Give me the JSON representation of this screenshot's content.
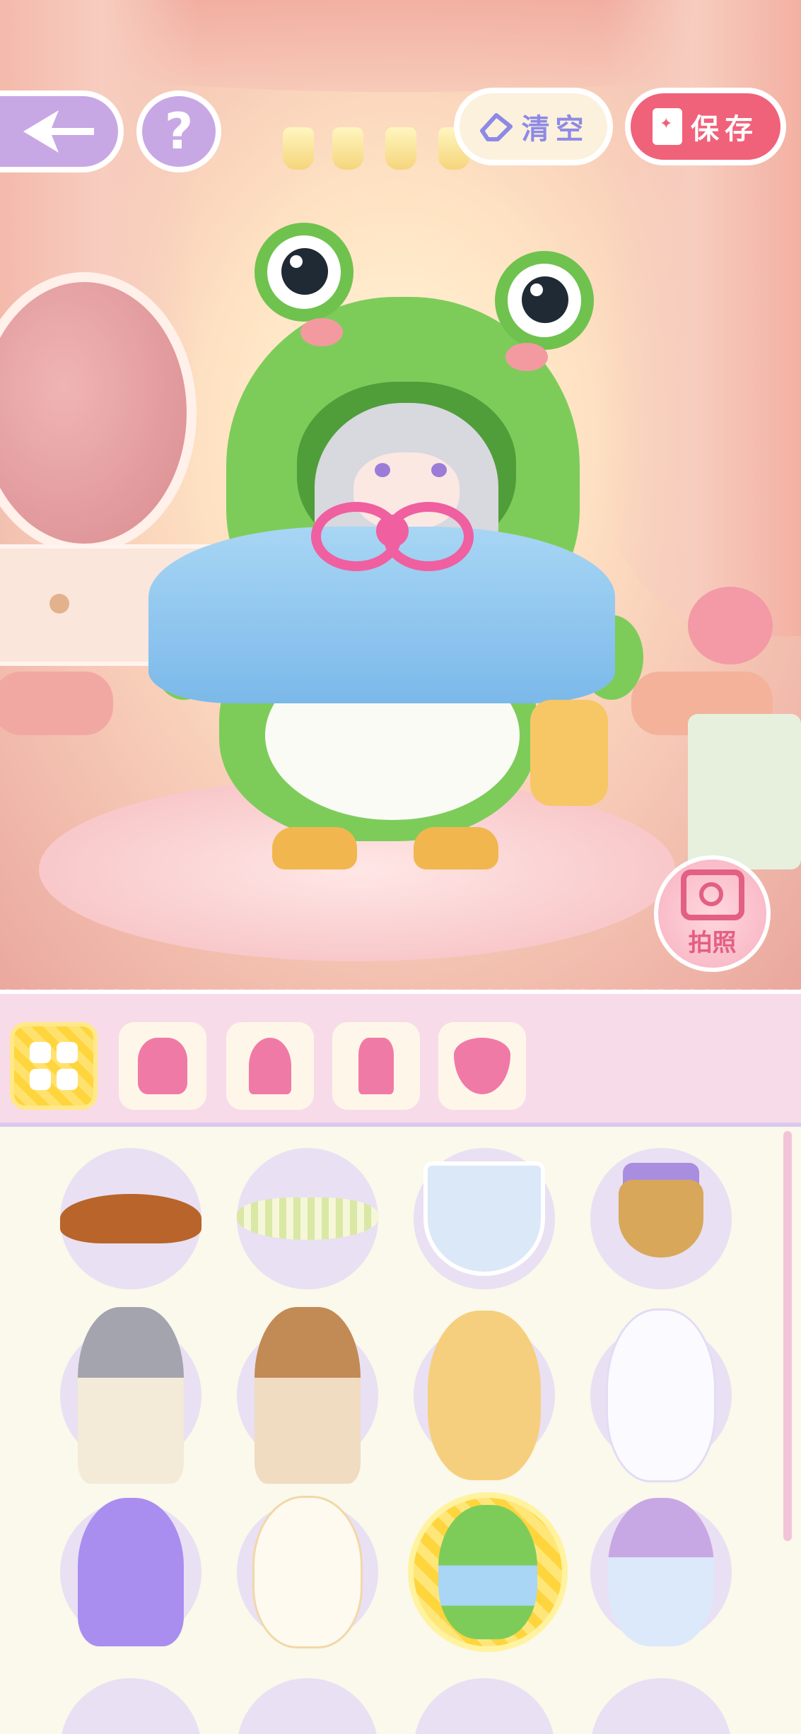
{
  "top_bar": {
    "clear_label": "清空",
    "save_label": "保存",
    "help_label": "?"
  },
  "camera": {
    "photo_label": "拍照"
  },
  "categories": [
    {
      "name": "all",
      "icon": "grid-icon",
      "selected": true
    },
    {
      "name": "hood",
      "icon": "hood-icon",
      "selected": false
    },
    {
      "name": "hat",
      "icon": "hat-icon",
      "selected": false
    },
    {
      "name": "outfit",
      "icon": "mannequin-icon",
      "selected": false
    },
    {
      "name": "necklace",
      "icon": "necklace-icon",
      "selected": false
    }
  ],
  "items": [
    {
      "name": "brown-polka-scarf"
    },
    {
      "name": "green-check-collar"
    },
    {
      "name": "poker-card-bib"
    },
    {
      "name": "flower-basket"
    },
    {
      "name": "grey-cat-costume"
    },
    {
      "name": "calico-cat-costume"
    },
    {
      "name": "bear-costume"
    },
    {
      "name": "bunny-costume"
    },
    {
      "name": "purple-octopus-costume"
    },
    {
      "name": "white-cat-costume"
    },
    {
      "name": "frog-costume",
      "selected": true
    },
    {
      "name": "hamster-costume"
    }
  ],
  "colors": {
    "accent_pink": "#f0617a",
    "selected_yellow": "#ffd53e",
    "panel_pink": "#f8dbe8",
    "button_purple": "#c7a8e4"
  }
}
